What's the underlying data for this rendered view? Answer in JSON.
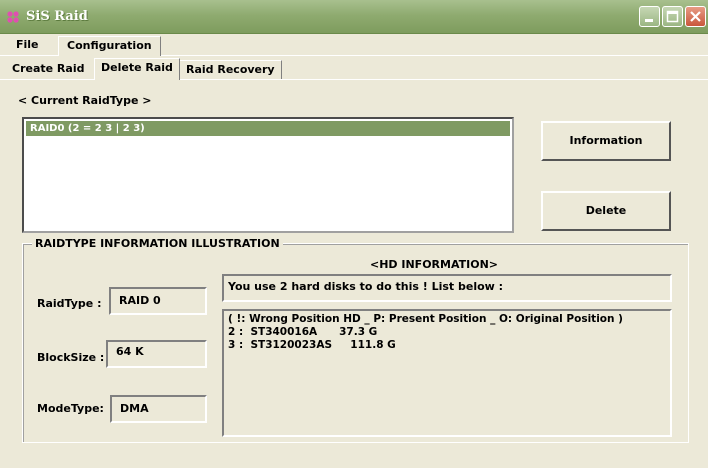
{
  "window": {
    "title": "SiS Raid",
    "accent": "#8fab70"
  },
  "menu": {
    "items": [
      "File",
      "Configuration"
    ]
  },
  "tabs": {
    "items": [
      "Create Raid",
      "Delete Raid",
      "Raid Recovery"
    ],
    "selected": "Delete Raid"
  },
  "current_raid": {
    "label": "< Current RaidType >",
    "items": [
      "RAID0 (2 = 2 3 | 2 3)"
    ],
    "selected_index": 0
  },
  "buttons": {
    "information": "Information",
    "delete": "Delete"
  },
  "illustration": {
    "title": "RAIDTYPE INFORMATION ILLUSTRATION",
    "raidtype_label": "RaidType :",
    "raidtype_value": "RAID 0",
    "blocksize_label": "BlockSize :",
    "blocksize_value": "64 K",
    "modetype_label": "ModeType:",
    "modetype_value": "DMA"
  },
  "hd_info": {
    "title": "<HD INFORMATION>",
    "summary": "You use 2 hard disks to do this ! List below :",
    "lines": [
      "( !: Wrong Position HD _ P: Present Position _ O: Original Position )",
      "2 :  ST340016A      37.3 G",
      "3 :  ST3120023AS     111.8 G"
    ]
  }
}
